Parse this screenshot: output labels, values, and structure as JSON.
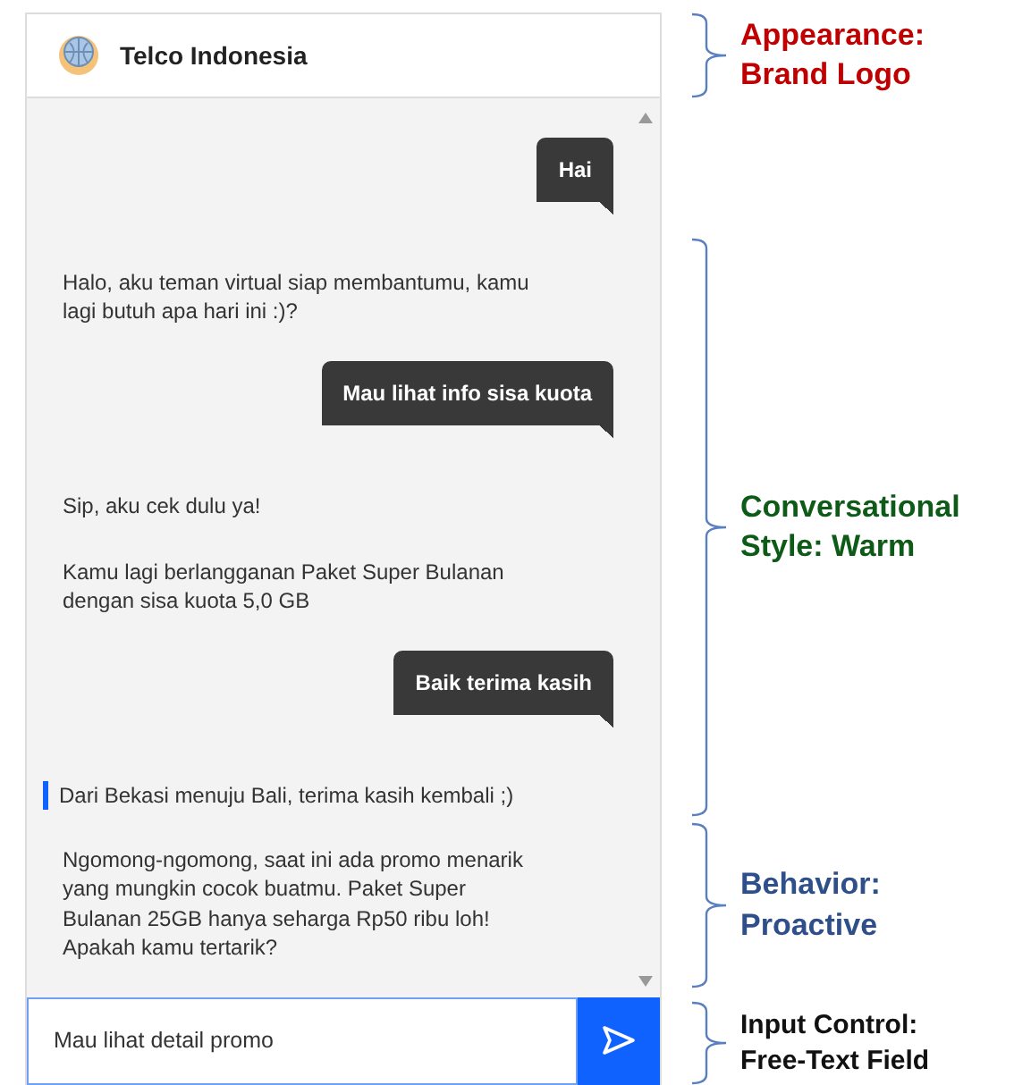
{
  "chat": {
    "title": "Telco Indonesia",
    "messages": [
      {
        "kind": "user",
        "text": "Hai"
      },
      {
        "kind": "bot",
        "text": "Halo, aku teman virtual siap membantumu, kamu lagi butuh apa hari ini :)?",
        "focused": false
      },
      {
        "kind": "user",
        "text": "Mau lihat info sisa kuota"
      },
      {
        "kind": "bot",
        "text": "Sip, aku cek dulu ya!",
        "focused": false
      },
      {
        "kind": "bot",
        "text": "Kamu lagi berlangganan Paket Super Bulanan dengan sisa kuota 5,0 GB",
        "focused": false
      },
      {
        "kind": "user",
        "text": "Baik terima kasih"
      },
      {
        "kind": "bot",
        "text": "Dari Bekasi menuju Bali, terima kasih kembali ;)",
        "focused": true
      },
      {
        "kind": "bot",
        "text": "Ngomong-ngomong, saat ini ada promo menarik yang mungkin cocok buatmu. Paket Super Bulanan 25GB hanya seharga Rp50 ribu loh! Apakah kamu tertarik?",
        "focused": false
      }
    ],
    "input": {
      "value": "Mau lihat detail promo"
    }
  },
  "annotations": [
    {
      "label": "Appearance: Brand Logo",
      "color": "#c00000"
    },
    {
      "label": "Conversational Style: Warm",
      "color": "#0e5a17"
    },
    {
      "label": "Behavior: Proactive",
      "color": "#2f4f8a"
    },
    {
      "label": "Input Control: Free-Text Field",
      "color": "#111111"
    }
  ]
}
